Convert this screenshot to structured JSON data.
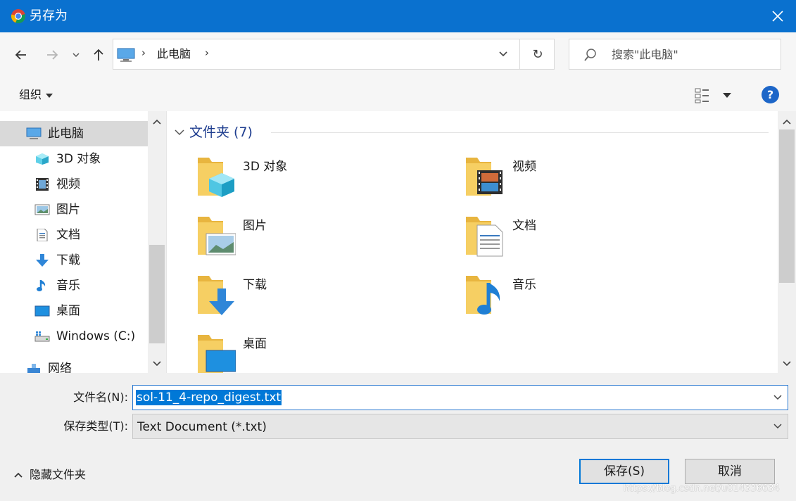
{
  "window": {
    "title": "另存为",
    "close_glyph": "✕"
  },
  "address": {
    "crumb": "此电脑",
    "separator": "›",
    "refresh_glyph": "↻"
  },
  "search": {
    "placeholder": "搜索\"此电脑\""
  },
  "toolbar": {
    "organize_label": "组织",
    "help_label": "?"
  },
  "sidebar": {
    "items": [
      {
        "label": "此电脑",
        "icon": "computer-icon"
      },
      {
        "label": "3D 对象",
        "icon": "cube-icon"
      },
      {
        "label": "视频",
        "icon": "film-icon"
      },
      {
        "label": "图片",
        "icon": "picture-icon"
      },
      {
        "label": "文档",
        "icon": "document-icon"
      },
      {
        "label": "下载",
        "icon": "download-arrow-icon"
      },
      {
        "label": "音乐",
        "icon": "music-note-icon"
      },
      {
        "label": "桌面",
        "icon": "desktop-icon"
      },
      {
        "label": "Windows (C:)",
        "icon": "drive-icon"
      },
      {
        "label": "网络",
        "icon": "network-icon"
      }
    ]
  },
  "main": {
    "group_label": "文件夹 (7)",
    "folders": [
      {
        "label": "3D 对象",
        "icon": "cube-icon"
      },
      {
        "label": "视频",
        "icon": "film-icon"
      },
      {
        "label": "图片",
        "icon": "picture-icon"
      },
      {
        "label": "文档",
        "icon": "document-icon"
      },
      {
        "label": "下载",
        "icon": "download-arrow-icon"
      },
      {
        "label": "音乐",
        "icon": "music-note-icon"
      },
      {
        "label": "桌面",
        "icon": "desktop-icon"
      }
    ]
  },
  "footer": {
    "filename_label": "文件名(N):",
    "filename_value": "sol-11_4-repo_digest.txt",
    "filetype_label": "保存类型(T):",
    "filetype_value": "Text Document (*.txt)",
    "hide_folders_label": "隐藏文件夹",
    "save_label": "保存(S)",
    "cancel_label": "取消",
    "watermark": "https://blog.csdn.net/u014336634"
  },
  "colors": {
    "titlebar": "#0a71cf",
    "accent": "#0078d7",
    "group_text": "#1e3d8f",
    "folder": "#f3c64f"
  }
}
